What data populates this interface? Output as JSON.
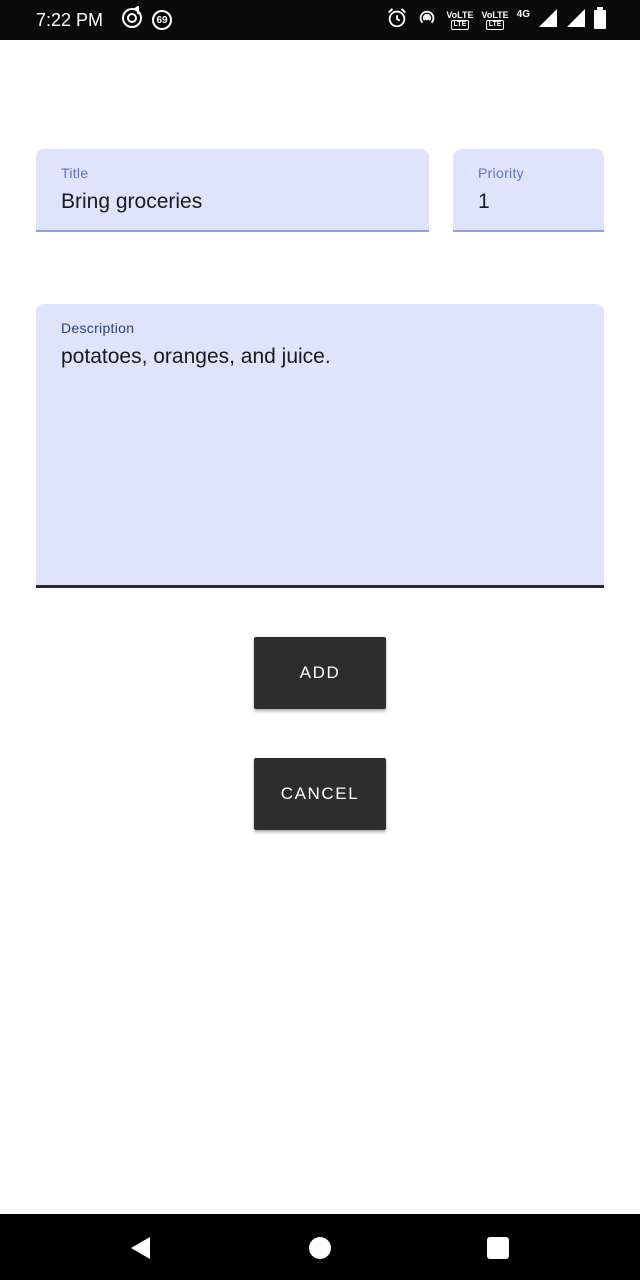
{
  "status_bar": {
    "time": "7:22 PM",
    "badge_count": "69",
    "sim1_label": "VoLTE",
    "sim1_sub": "LTE",
    "sim2_label": "VoLTE",
    "sim2_sub": "LTE",
    "network": "4G",
    "icons": [
      "music-sync-icon",
      "notification-badge-icon",
      "alarm-icon",
      "hotspot-icon",
      "volte-icon",
      "signal-icon",
      "battery-icon"
    ]
  },
  "form": {
    "title_label": "Title",
    "title_value": "Bring groceries",
    "priority_label": "Priority",
    "priority_value": "1",
    "description_label": "Description",
    "description_value": "potatoes, oranges, and juice."
  },
  "actions": {
    "add_label": "ADD",
    "cancel_label": "CANCEL"
  },
  "colors": {
    "field_background": "#dfe3fb",
    "label_color": "#5f72c6",
    "button_background": "#2d2d2d"
  },
  "nav_bar": {
    "icons": [
      "back-icon",
      "home-icon",
      "recents-icon"
    ]
  }
}
